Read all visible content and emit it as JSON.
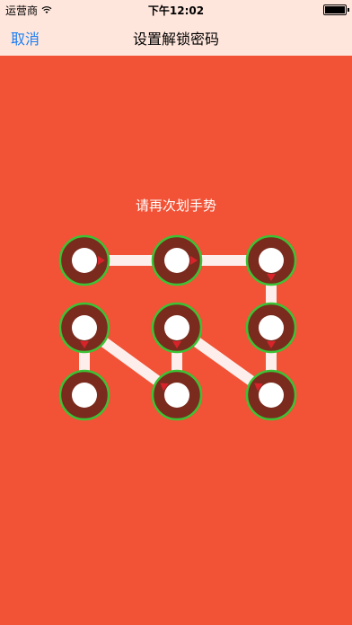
{
  "status_bar": {
    "carrier": "运营商",
    "time": "下午12:02",
    "wifi_icon": "wifi-icon",
    "battery_icon": "battery-icon"
  },
  "nav": {
    "cancel_label": "取消",
    "title": "设置解锁密码"
  },
  "prompt": "请再次划手势",
  "colors": {
    "background": "#f25235",
    "bar_background": "#ffe6dc",
    "link": "#1a7ef5",
    "node_ring": "#7a2b1e",
    "node_outline": "#3cc235",
    "node_center": "#ffffff",
    "arrow": "#d9232a"
  },
  "gesture": {
    "grid": 3,
    "nodes": [
      {
        "index": 1,
        "row": 0,
        "col": 0,
        "selected": true
      },
      {
        "index": 2,
        "row": 0,
        "col": 1,
        "selected": true
      },
      {
        "index": 3,
        "row": 0,
        "col": 2,
        "selected": true
      },
      {
        "index": 4,
        "row": 1,
        "col": 0,
        "selected": true
      },
      {
        "index": 5,
        "row": 1,
        "col": 1,
        "selected": true
      },
      {
        "index": 6,
        "row": 1,
        "col": 2,
        "selected": true
      },
      {
        "index": 7,
        "row": 2,
        "col": 0,
        "selected": true
      },
      {
        "index": 8,
        "row": 2,
        "col": 1,
        "selected": true
      },
      {
        "index": 9,
        "row": 2,
        "col": 2,
        "selected": true
      }
    ],
    "sequence": [
      1,
      2,
      3,
      6,
      9,
      5,
      8,
      4,
      7
    ]
  }
}
